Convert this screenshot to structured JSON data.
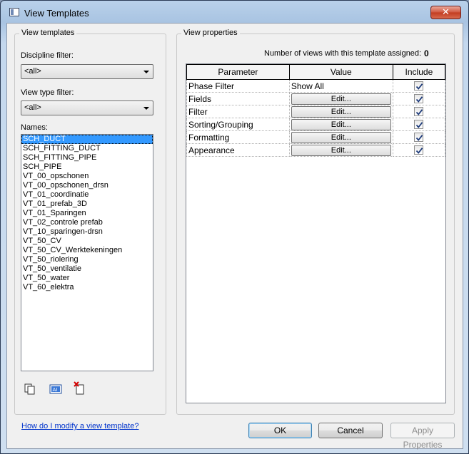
{
  "window": {
    "title": "View Templates",
    "close_glyph": "✕"
  },
  "left": {
    "group_title": "View templates",
    "discipline_label": "Discipline filter:",
    "discipline_value": "<all>",
    "viewtype_label": "View type filter:",
    "viewtype_value": "<all>",
    "names_label": "Names:",
    "names": [
      "SCH_DUCT",
      "SCH_FITTING_DUCT",
      "SCH_FITTING_PIPE",
      "SCH_PIPE",
      "VT_00_opschonen",
      "VT_00_opschonen_drsn",
      "VT_01_coordinatie",
      "VT_01_prefab_3D",
      "VT_01_Sparingen",
      "VT_02_controle prefab",
      "VT_10_sparingen-drsn",
      "VT_50_CV",
      "VT_50_CV_Werktekeningen",
      "VT_50_riolering",
      "VT_50_ventilatie",
      "VT_50_water",
      "VT_60_elektra"
    ],
    "selected_name": "SCH_DUCT",
    "tool_icons": [
      "duplicate-icon",
      "rename-icon",
      "delete-icon"
    ]
  },
  "right": {
    "group_title": "View properties",
    "count_label": "Number of views with this template assigned:",
    "count_value": "0",
    "columns": [
      "Parameter",
      "Value",
      "Include"
    ],
    "rows": [
      {
        "parameter": "Phase Filter",
        "value": "Show All",
        "is_button": false,
        "include": true
      },
      {
        "parameter": "Fields",
        "value": "Edit...",
        "is_button": true,
        "include": true
      },
      {
        "parameter": "Filter",
        "value": "Edit...",
        "is_button": true,
        "include": true
      },
      {
        "parameter": "Sorting/Grouping",
        "value": "Edit...",
        "is_button": true,
        "include": true
      },
      {
        "parameter": "Formatting",
        "value": "Edit...",
        "is_button": true,
        "include": true
      },
      {
        "parameter": "Appearance",
        "value": "Edit...",
        "is_button": true,
        "include": true
      }
    ]
  },
  "footer": {
    "help_link": "How do I modify a view template?",
    "ok": "OK",
    "cancel": "Cancel",
    "apply": "Apply Properties"
  }
}
